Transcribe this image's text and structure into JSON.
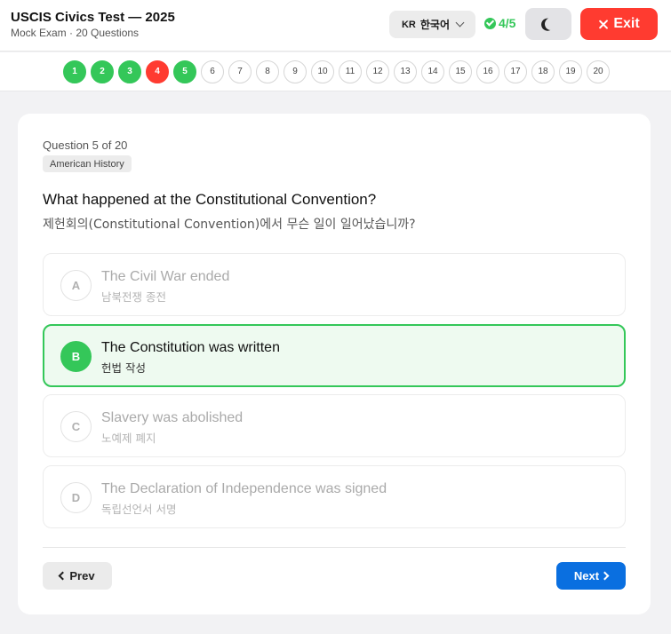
{
  "header": {
    "title": "USCIS Civics Test — 2025",
    "subtitle": "Mock Exam · 20 Questions",
    "language": {
      "code": "KR",
      "name": "한국어"
    },
    "score": "4/5",
    "exit_label": "Exit"
  },
  "progress": {
    "dots": [
      {
        "label": "1",
        "status": "correct"
      },
      {
        "label": "2",
        "status": "correct"
      },
      {
        "label": "3",
        "status": "correct"
      },
      {
        "label": "4",
        "status": "wrong"
      },
      {
        "label": "5",
        "status": "correct"
      },
      {
        "label": "6",
        "status": "unanswered"
      },
      {
        "label": "7",
        "status": "unanswered"
      },
      {
        "label": "8",
        "status": "unanswered"
      },
      {
        "label": "9",
        "status": "unanswered"
      },
      {
        "label": "10",
        "status": "unanswered"
      },
      {
        "label": "11",
        "status": "unanswered"
      },
      {
        "label": "12",
        "status": "unanswered"
      },
      {
        "label": "13",
        "status": "unanswered"
      },
      {
        "label": "14",
        "status": "unanswered"
      },
      {
        "label": "15",
        "status": "unanswered"
      },
      {
        "label": "16",
        "status": "unanswered"
      },
      {
        "label": "17",
        "status": "unanswered"
      },
      {
        "label": "18",
        "status": "unanswered"
      },
      {
        "label": "19",
        "status": "unanswered"
      },
      {
        "label": "20",
        "status": "unanswered"
      }
    ]
  },
  "question": {
    "counter": "Question 5 of 20",
    "category": "American History",
    "text_en": "What happened at the Constitutional Convention?",
    "text_ko": "제헌회의(Constitutional Convention)에서 무슨 일이 일어났습니까?",
    "options": [
      {
        "letter": "A",
        "en": "The Civil War ended",
        "ko": "남북전쟁 종전"
      },
      {
        "letter": "B",
        "en": "The Constitution was written",
        "ko": "헌법 작성"
      },
      {
        "letter": "C",
        "en": "Slavery was abolished",
        "ko": "노예제 폐지"
      },
      {
        "letter": "D",
        "en": "The Declaration of Independence was signed",
        "ko": "독립선언서 서명"
      }
    ],
    "selected": "B"
  },
  "nav": {
    "prev_label": "Prev",
    "next_label": "Next"
  },
  "colors": {
    "correct": "#34c759",
    "wrong": "#ff3b30",
    "accent": "#0a6fe0",
    "exit": "#ff3b30"
  },
  "icons": {
    "language": "chevron-down-icon",
    "score": "check-circle-icon",
    "theme": "moon-icon",
    "exit": "close-icon",
    "prev": "chevron-left-icon",
    "next": "chevron-right-icon"
  }
}
